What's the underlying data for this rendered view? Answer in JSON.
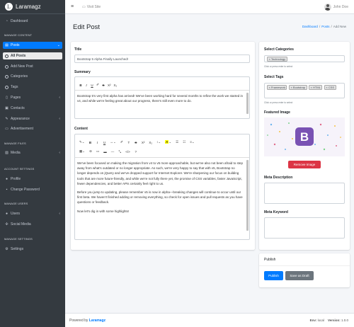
{
  "brand": {
    "name": "Laramagz",
    "logo_letter": "L"
  },
  "topbar": {
    "visit_site": "Visit Site",
    "user_name": "John Doe"
  },
  "sidebar": {
    "dashboard": "Dashboard",
    "h_manage_content": "MANAGE CONTENT",
    "posts": "Posts",
    "all_posts": "All Posts",
    "add_new_post": "Add New Post",
    "categories": "Categories",
    "tags": "Tags",
    "pages": "Pages",
    "contacts": "Contacts",
    "appearance": "Appearance",
    "advertisement": "Advertisement",
    "h_manage_files": "MANAGE FILES",
    "media": "Media",
    "h_account_settings": "ACCOUNT SETTINGS",
    "profile": "Profile",
    "change_password": "Change Password",
    "h_manage_users": "MANAGE USERS",
    "users": "Users",
    "social_media": "Social Media",
    "h_manage_settings": "MANAGE SETTINGS",
    "settings": "Settings"
  },
  "page": {
    "title": "Edit Post",
    "breadcrumb": [
      "Dashboard",
      "Posts",
      "Add New"
    ],
    "sep": "/"
  },
  "form": {
    "title_label": "Title",
    "title_value": "Bootstrap 5 Alpha Finally Launched!",
    "summary_label": "Summary",
    "summary_text": "Bootstrap 5's very first alpha has arrived! We've been working hard for several months to refine the work we started in v4, and while we're feeling great about our progress, there's still even more to do.",
    "content_label": "Content",
    "content_p1": "We've been focused on making the migration from v4 to v5 more approachable, but we've also not been afraid to step away from what's outdated or no longer appropriate. As such, we're very happy to say that with v5, Bootstrap no longer depends on jQuery and we've dropped support for Internet Explorer. We're sharpening our focus on building tools that are more future-friendly, and while we're not fully there yet, the promise of CSS variables, faster JavaScript, fewer dependencies, and better APIs certainly feel right to us.",
    "content_p2": "Before you jump to updating, please remember v5 is now in alpha—breaking changes will continue to occur until our first beta. We haven't finished adding or removing everything, so check for open issues and pull requests as you have questions or feedback.",
    "content_p3": "Now let's dig in with some highlights!"
  },
  "side": {
    "categories_label": "Select Categories",
    "category_tag": "Technology",
    "help_text": "Click or press enter to select",
    "tags_label": "Select Tags",
    "tags": [
      "Framework",
      "Bootstrap",
      "HTML",
      "CSS"
    ],
    "featured_label": "Featured Image",
    "remove_image": "Remove Image",
    "meta_desc_label": "Meta Description",
    "meta_kw_label": "Meta Keyword",
    "publish_title": "Publish",
    "publish_btn": "Publish",
    "draft_btn": "Save as Draft"
  },
  "footer": {
    "powered": "Powered by",
    "brand": "Laramagz",
    "env_label": "Env:",
    "env_value": "local",
    "version_label": "Version:",
    "version_value": "1.0.0"
  },
  "colors": {
    "primary": "#007bff",
    "danger": "#dc3545",
    "sidebar": "#343a40",
    "bootstrap": "#7952b3"
  }
}
